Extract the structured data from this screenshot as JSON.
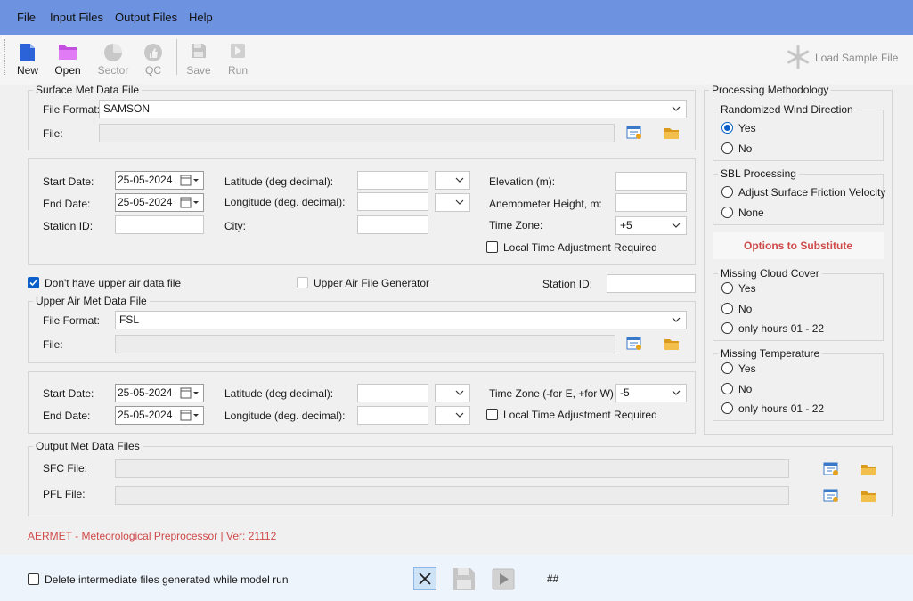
{
  "menu": {
    "file": "File",
    "input_files": "Input Files",
    "output_files": "Output Files",
    "help": "Help"
  },
  "toolbar": {
    "new": "New",
    "open": "Open",
    "sector": "Sector",
    "qc": "QC",
    "save": "Save",
    "run": "Run",
    "load_sample": "Load Sample File"
  },
  "surface": {
    "group_title": "Surface Met Data File",
    "file_format_label": "File Format:",
    "file_format_value": "SAMSON",
    "file_label": "File:",
    "start_date_label": "Start Date:",
    "start_date": "25-05-2024",
    "end_date_label": "End Date:",
    "end_date": "25-05-2024",
    "station_id_label": "Station ID:",
    "latitude_label": "Latitude (deg decimal):",
    "longitude_label": "Longitude (deg. decimal):",
    "city_label": "City:",
    "elevation_label": "Elevation (m):",
    "anemometer_label": "Anemometer Height, m:",
    "timezone_label": "Time Zone:",
    "timezone_value": "+5",
    "local_time_label": "Local Time Adjustment Required"
  },
  "upper": {
    "no_upper_label": "Don't have upper air data file",
    "generator_label": "Upper Air File Generator",
    "station_id_label": "Station ID:",
    "group_title": "Upper Air Met Data File",
    "file_format_label": "File Format:",
    "file_format_value": "FSL",
    "file_label": "File:",
    "start_date_label": "Start Date:",
    "start_date": "25-05-2024",
    "end_date_label": "End Date:",
    "end_date": "25-05-2024",
    "latitude_label": "Latitude (deg decimal):",
    "longitude_label": "Longitude (deg. decimal):",
    "timezone_label": "Time Zone (-for E, +for W)",
    "timezone_value": "-5",
    "local_time_label": "Local Time Adjustment Required"
  },
  "output": {
    "group_title": "Output Met Data Files",
    "sfc_label": "SFC File:",
    "pfl_label": "PFL File:"
  },
  "processing": {
    "title": "Processing Methodology",
    "wind_title": "Randomized Wind Direction",
    "wind_yes": "Yes",
    "wind_no": "No",
    "sbl_title": "SBL Processing",
    "sbl_adjust": "Adjust Surface Friction Velocity",
    "sbl_none": "None",
    "substitute": "Options to Substitute",
    "cloud_title": "Missing Cloud Cover",
    "cloud_yes": "Yes",
    "cloud_no": "No",
    "cloud_hours": "only hours 01 - 22",
    "temp_title": "Missing Temperature",
    "temp_yes": "Yes",
    "temp_no": "No",
    "temp_hours": "only hours 01 - 22"
  },
  "status": {
    "version": "AERMET - Meteorological Preprocessor | Ver: 21112"
  },
  "footer": {
    "delete_label": "Delete intermediate files generated while model run",
    "hash": "##"
  },
  "colors": {
    "menubar": "#6d93e0",
    "accent": "#0a5fc8",
    "version_text": "#d04a4a",
    "substitute_text": "#d04a4a"
  }
}
